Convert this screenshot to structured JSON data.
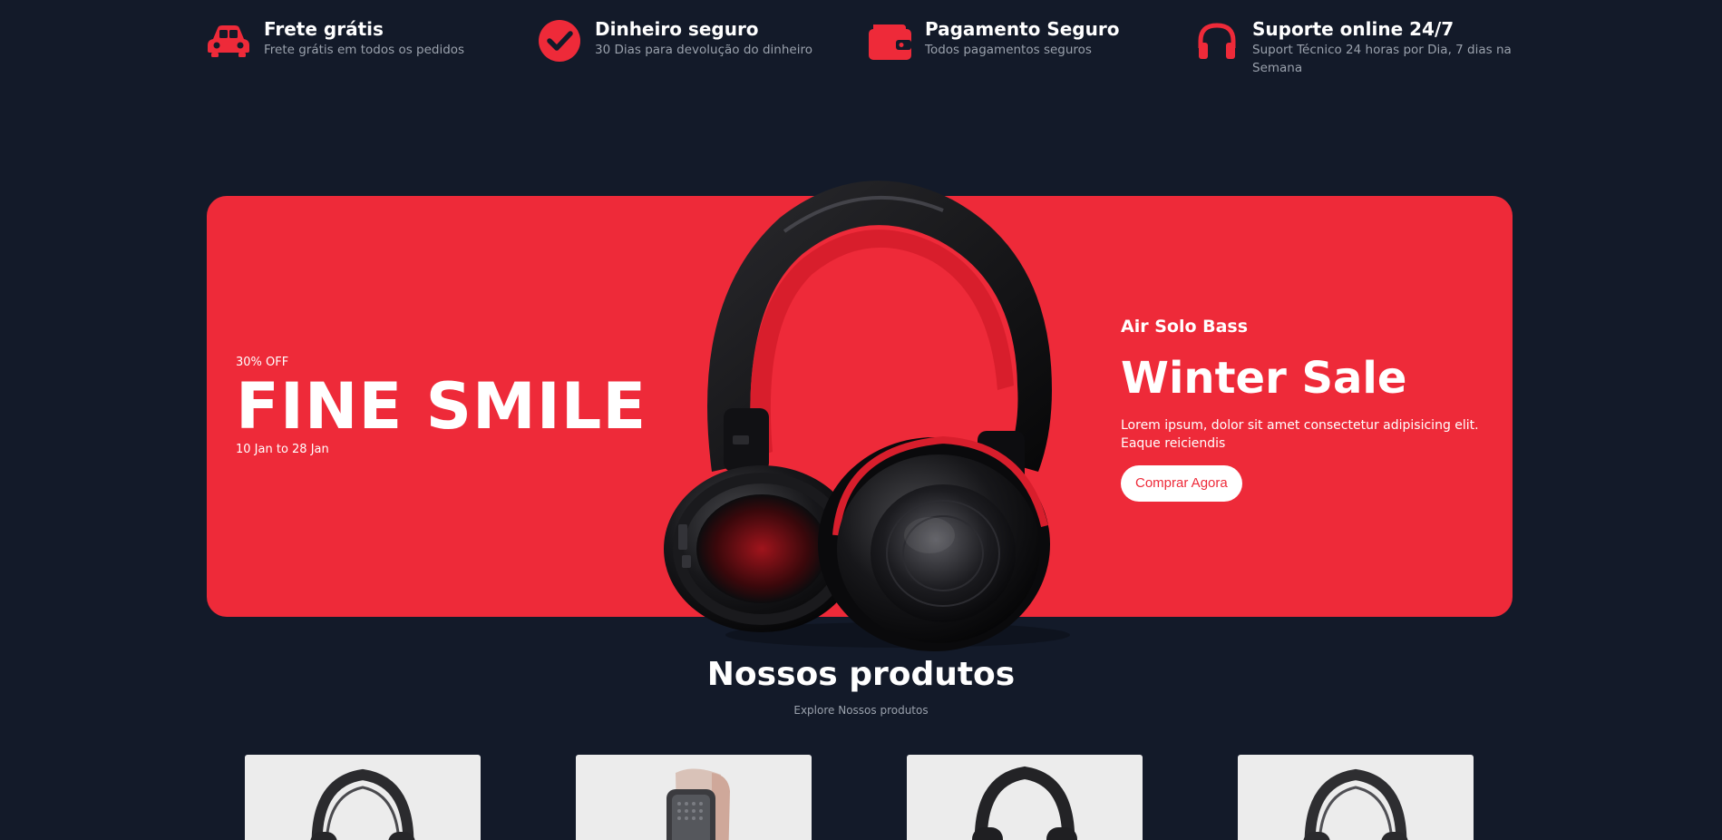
{
  "features": [
    {
      "icon": "car-icon",
      "title": "Frete grátis",
      "desc": "Frete grátis em todos os pedidos"
    },
    {
      "icon": "check-circle-icon",
      "title": "Dinheiro seguro",
      "desc": "30 Dias para devolução do dinheiro"
    },
    {
      "icon": "wallet-icon",
      "title": "Pagamento Seguro",
      "desc": "Todos pagamentos seguros"
    },
    {
      "icon": "headset-icon",
      "title": "Suporte online 24/7",
      "desc": "Suport Técnico 24 horas por Dia, 7 dias na Semana"
    }
  ],
  "banner": {
    "discount": "30% OFF",
    "title": "FINE SMILE",
    "date_range": "10 Jan to 28 Jan",
    "product_name": "Air Solo Bass",
    "sale_title": "Winter Sale",
    "description": "Lorem ipsum, dolor sit amet consectetur adipisicing elit. Eaque reiciendis",
    "cta_label": "Comprar Agora",
    "image": "headphones-image"
  },
  "products_section": {
    "title": "Nossos produtos",
    "subtitle": "Explore Nossos produtos"
  },
  "products": [
    {
      "image": "headphones-image"
    },
    {
      "image": "smartwatch-image"
    },
    {
      "image": "headphones-image"
    },
    {
      "image": "headphones-image"
    }
  ],
  "colors": {
    "background": "#131a29",
    "accent": "#ee2a39",
    "text": "#ffffff",
    "muted_text": "#9aa1ac",
    "card_background": "#ececec"
  }
}
